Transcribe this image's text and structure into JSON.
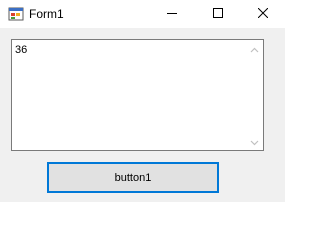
{
  "window": {
    "title": "Form1",
    "icon": "winforms-app-icon",
    "controls": {
      "minimize_icon": "minimize-icon",
      "maximize_icon": "maximize-icon",
      "close_icon": "close-icon"
    }
  },
  "textbox": {
    "value": "36",
    "scrollbar": {
      "up_icon": "scroll-up-arrow-icon",
      "down_icon": "scroll-down-arrow-icon"
    }
  },
  "button1": {
    "label": "button1"
  },
  "colors": {
    "accent_border": "#0078d7",
    "client_background": "#f0f0f0",
    "button_face": "#e1e1e1"
  }
}
